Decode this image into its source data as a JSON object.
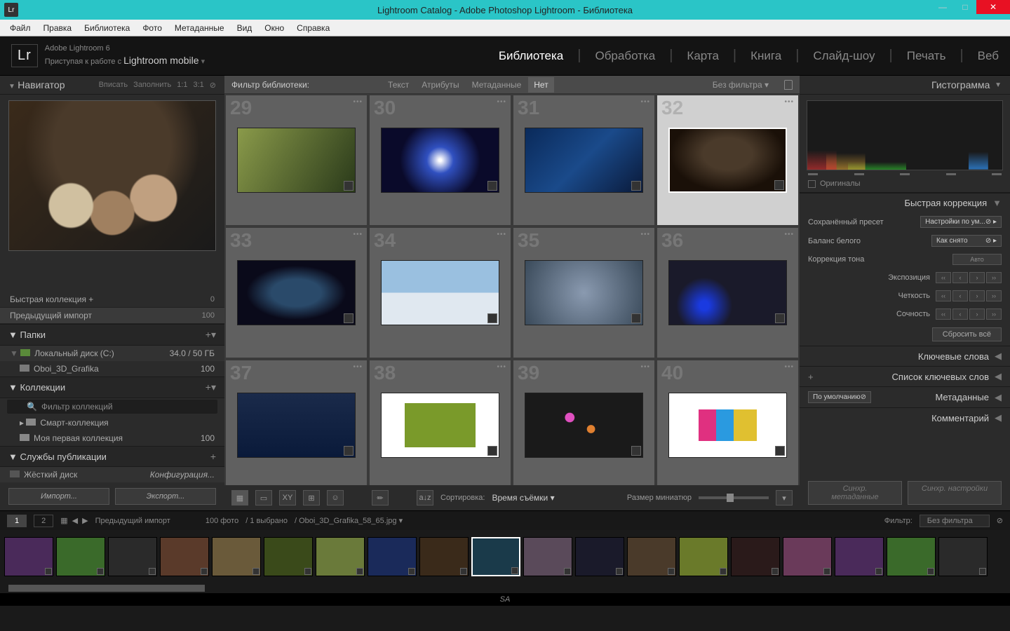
{
  "window": {
    "title": "Lightroom Catalog - Adobe Photoshop Lightroom - Библиотека",
    "app_icon": "Lr"
  },
  "menubar": [
    "Файл",
    "Правка",
    "Библиотека",
    "Фото",
    "Метаданные",
    "Вид",
    "Окно",
    "Справка"
  ],
  "identity": {
    "logo": "Lr",
    "line1": "Adobe Lightroom 6",
    "line2_a": "Приступая к работе с ",
    "line2_b": "Lightroom mobile"
  },
  "modules": [
    "Библиотека",
    "Обработка",
    "Карта",
    "Книга",
    "Слайд-шоу",
    "Печать",
    "Веб"
  ],
  "active_module": 0,
  "navigator": {
    "title": "Навигатор",
    "opts": [
      "Вписать",
      "Заполнить",
      "1:1",
      "3:1"
    ]
  },
  "catalog": {
    "quick": {
      "label": "Быстрая коллекция  +",
      "count": "0"
    },
    "prev": {
      "label": "Предыдущий импорт",
      "count": "100"
    }
  },
  "folders": {
    "title": "Папки",
    "disk": {
      "label": "Локальный диск (C:)",
      "size": "34.0 / 50 ГБ"
    },
    "folder": {
      "label": "Oboi_3D_Grafika",
      "count": "100"
    }
  },
  "collections": {
    "title": "Коллекции",
    "filter_ph": "Фильтр коллекций",
    "smart": "Смарт-коллекция",
    "mine": {
      "label": "Моя первая коллекция",
      "count": "100"
    }
  },
  "publish": {
    "title": "Службы публикации",
    "hdd": "Жёсткий диск",
    "config": "Конфигурация..."
  },
  "import_btn": "Импорт...",
  "export_btn": "Экспорт...",
  "filterbar": {
    "label": "Фильтр библиотеки:",
    "tabs": [
      "Текст",
      "Атрибуты",
      "Метаданные",
      "Нет"
    ],
    "active": 3,
    "nofilter": "Без фильтра"
  },
  "grid_start": 29,
  "toolbar": {
    "sort_lbl": "Сортировка:",
    "sort_val": "Время съёмки",
    "thumb_lbl": "Размер миниатюр"
  },
  "sync_meta": "Синхр. метаданные",
  "sync_settings": "Синхр. настройки",
  "right": {
    "histogram": "Гистограмма",
    "originals": "Оригиналы",
    "quickdev": "Быстрая коррекция",
    "preset_lbl": "Сохранённый пресет",
    "preset_val": "Настройки по ум...",
    "wb_lbl": "Баланс белого",
    "wb_val": "Как снято",
    "tone_lbl": "Коррекция тона",
    "auto": "Авто",
    "exposure": "Экспозиция",
    "clarity": "Четкость",
    "vibrance": "Сочность",
    "reset": "Сбросить всё",
    "keywords": "Ключевые слова",
    "keyword_list": "Список ключевых слов",
    "metadata": "Метаданные",
    "metadata_preset": "По умолчанию",
    "comments": "Комментарий"
  },
  "secbar": {
    "views": [
      "1",
      "2"
    ],
    "breadcrumb": "Предыдущий импорт",
    "count": "100 фото",
    "selected": "/ 1 выбрано",
    "file": "/ Oboi_3D_Grafika_58_65.jpg",
    "filter_lbl": "Фильтр:",
    "filter_val": "Без фильтра"
  },
  "status": "SA"
}
